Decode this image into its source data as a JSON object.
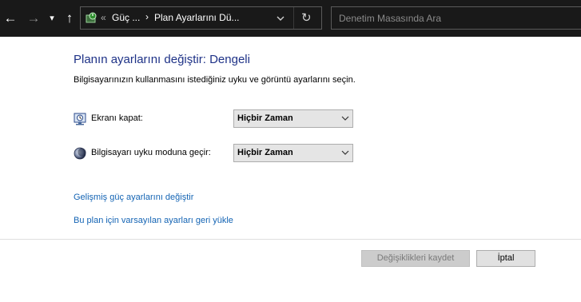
{
  "nav": {
    "back_glyph": "←",
    "forward_glyph": "→",
    "recent_glyph": "▾",
    "up_glyph": "↑"
  },
  "address_bar": {
    "icon": "power-options-icon",
    "overflow": "«",
    "crumbs": [
      "Güç ...",
      "Plan Ayarlarını Dü..."
    ],
    "separator": "›",
    "refresh_glyph": "↻"
  },
  "search": {
    "placeholder": "Denetim Masasında Ara",
    "value": ""
  },
  "main": {
    "title": "Planın ayarlarını değiştir: Dengeli",
    "subtitle": "Bilgisayarınızın kullanmasını istediğiniz uyku ve görüntü ayarlarını seçin.",
    "settings": [
      {
        "icon": "monitor-clock-icon",
        "label": "Ekranı kapat:",
        "value": "Hiçbir Zaman"
      },
      {
        "icon": "sleep-moon-icon",
        "label": "Bilgisayarı uyku moduna geçir:",
        "value": "Hiçbir Zaman"
      }
    ],
    "links": {
      "advanced": "Gelişmiş güç ayarlarını değiştir",
      "restore": "Bu plan için varsayılan ayarları geri yükle"
    }
  },
  "buttons": {
    "save": "Değişiklikleri kaydet",
    "cancel": "İptal"
  },
  "colors": {
    "titlebar_bg": "#191919",
    "title_text": "#1e3287",
    "link_text": "#1464b4"
  }
}
